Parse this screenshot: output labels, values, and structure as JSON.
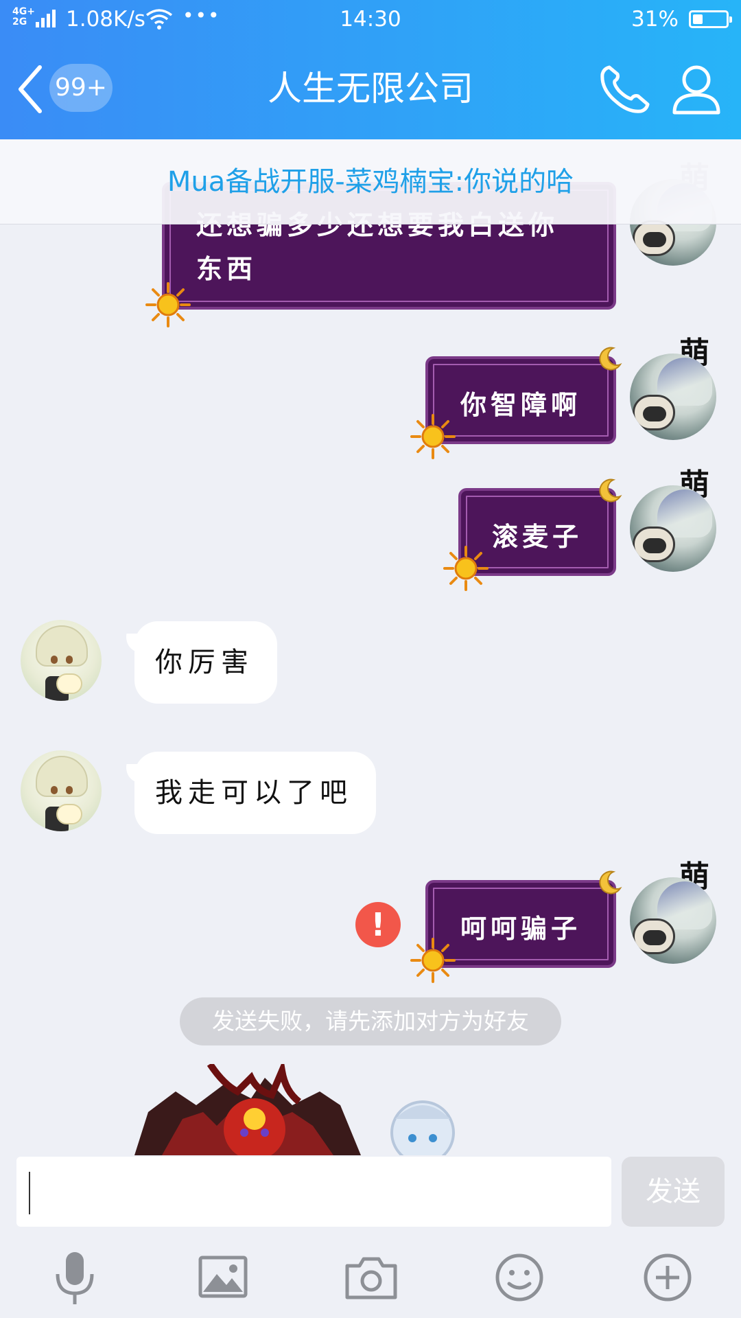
{
  "status_bar": {
    "network": "4G+\n2G",
    "speed": "1.08K/s",
    "dots": "•••",
    "time": "14:30",
    "battery_percent": "31%",
    "battery_level": 0.31
  },
  "header": {
    "unread_badge": "99+",
    "title": "人生无限公司",
    "icons": [
      "chevron-left-icon",
      "phone-icon",
      "person-icon"
    ]
  },
  "notice": {
    "text": "Mua备战开服-菜鸡楠宝:你说的哈"
  },
  "messages": [
    {
      "from": "me",
      "line1": "还想骗多少还想要我白送你",
      "line2": "东西",
      "name": "萌"
    },
    {
      "from": "me",
      "text": "你智障啊",
      "name": "萌"
    },
    {
      "from": "me",
      "text": "滚麦子",
      "name": "萌"
    },
    {
      "from": "other",
      "text": "你厉害"
    },
    {
      "from": "other",
      "text": "我走可以了吧"
    },
    {
      "from": "me",
      "text": "呵呵骗子",
      "name": "萌",
      "failed": true
    }
  ],
  "error_mark": "!",
  "system_tip": "发送失败，请先添加对方为好友",
  "input": {
    "value": "",
    "placeholder": "",
    "send_label": "发送"
  },
  "toolbar": [
    "microphone-icon",
    "image-icon",
    "camera-icon",
    "emoji-icon",
    "plus-icon"
  ],
  "colors": {
    "header_start": "#3a8cf6",
    "header_end": "#27b4f8",
    "bubble_purple": "#4d155a",
    "notice_text": "#1fa0e8",
    "error_red": "#f2574a",
    "background": "#eef0f6"
  }
}
